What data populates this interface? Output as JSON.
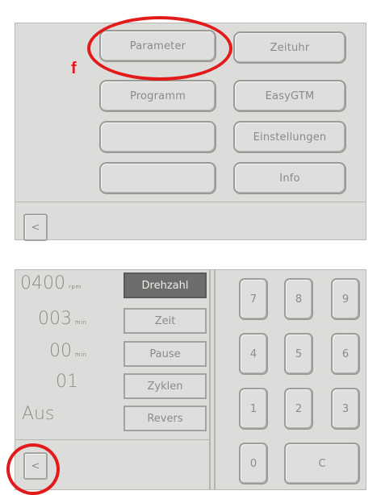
{
  "top_screen": {
    "menu": {
      "parameter": "Parameter",
      "zeituhr": "Zeituhr",
      "programm": "Programm",
      "easygtm": "EasyGTM",
      "empty1": "",
      "einstellungen": "Einstellungen",
      "empty2": "",
      "info": "Info"
    },
    "back_label": "<",
    "annotation_letter": "f"
  },
  "bottom_screen": {
    "values": [
      {
        "number": "0400",
        "unit": "rpm"
      },
      {
        "number": "003",
        "unit": "min"
      },
      {
        "number": "00",
        "unit": "min"
      },
      {
        "number": "01",
        "unit": ""
      },
      {
        "number": "Aus",
        "unit": ""
      }
    ],
    "tabs": [
      {
        "label": "Drehzahl",
        "active": true
      },
      {
        "label": "Zeit",
        "active": false
      },
      {
        "label": "Pause",
        "active": false
      },
      {
        "label": "Zyklen",
        "active": false
      },
      {
        "label": "Revers",
        "active": false
      }
    ],
    "keypad": [
      "7",
      "8",
      "9",
      "4",
      "5",
      "6",
      "1",
      "2",
      "3",
      "0",
      "C"
    ],
    "back_label": "<"
  },
  "colors": {
    "annotation": "#e21a1a",
    "active_tab": "#6d6d6b",
    "screen_bg": "#dcdcda"
  }
}
